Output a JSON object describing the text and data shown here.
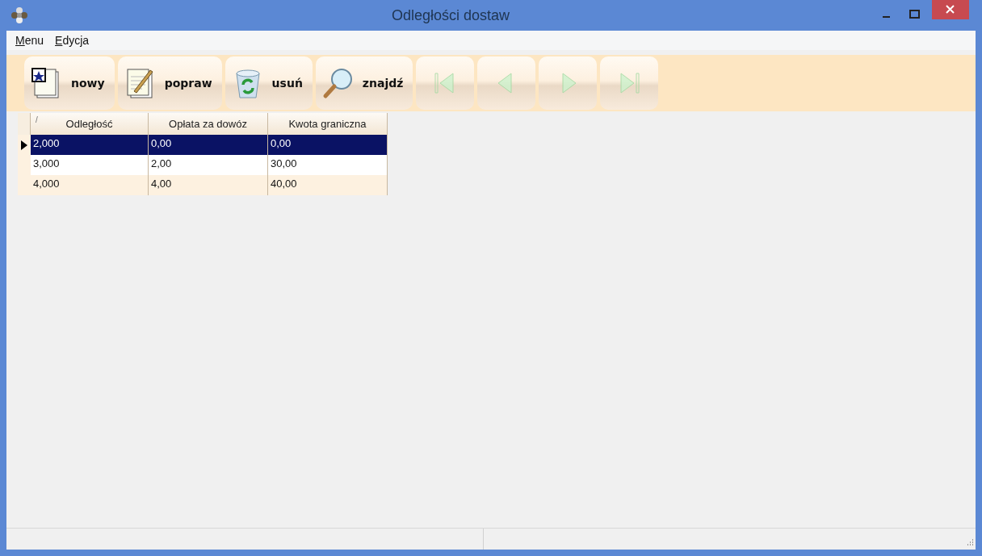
{
  "window": {
    "title": "Odległości dostaw"
  },
  "menu": [
    {
      "label": "Menu"
    },
    {
      "label": "Edycja"
    }
  ],
  "toolbar": [
    {
      "kind": "new",
      "label": "nowy",
      "disabled": false
    },
    {
      "kind": "edit",
      "label": "popraw",
      "disabled": false
    },
    {
      "kind": "delete",
      "label": "usuń",
      "disabled": false
    },
    {
      "kind": "find",
      "label": "znajdź",
      "disabled": false
    },
    {
      "kind": "first",
      "disabled": true
    },
    {
      "kind": "prev",
      "disabled": true
    },
    {
      "kind": "next",
      "disabled": true
    },
    {
      "kind": "last",
      "disabled": true
    }
  ],
  "table": {
    "sort_mark": "/",
    "columns": [
      "Odległość",
      "Opłata za dowóz",
      "Kwota graniczna"
    ],
    "rows": [
      {
        "cells": [
          "2,000",
          "0,00",
          "0,00"
        ],
        "selected": true
      },
      {
        "cells": [
          "3,000",
          "2,00",
          "30,00"
        ],
        "selected": false
      },
      {
        "cells": [
          "4,000",
          "4,00",
          "40,00"
        ],
        "selected": false
      }
    ]
  }
}
